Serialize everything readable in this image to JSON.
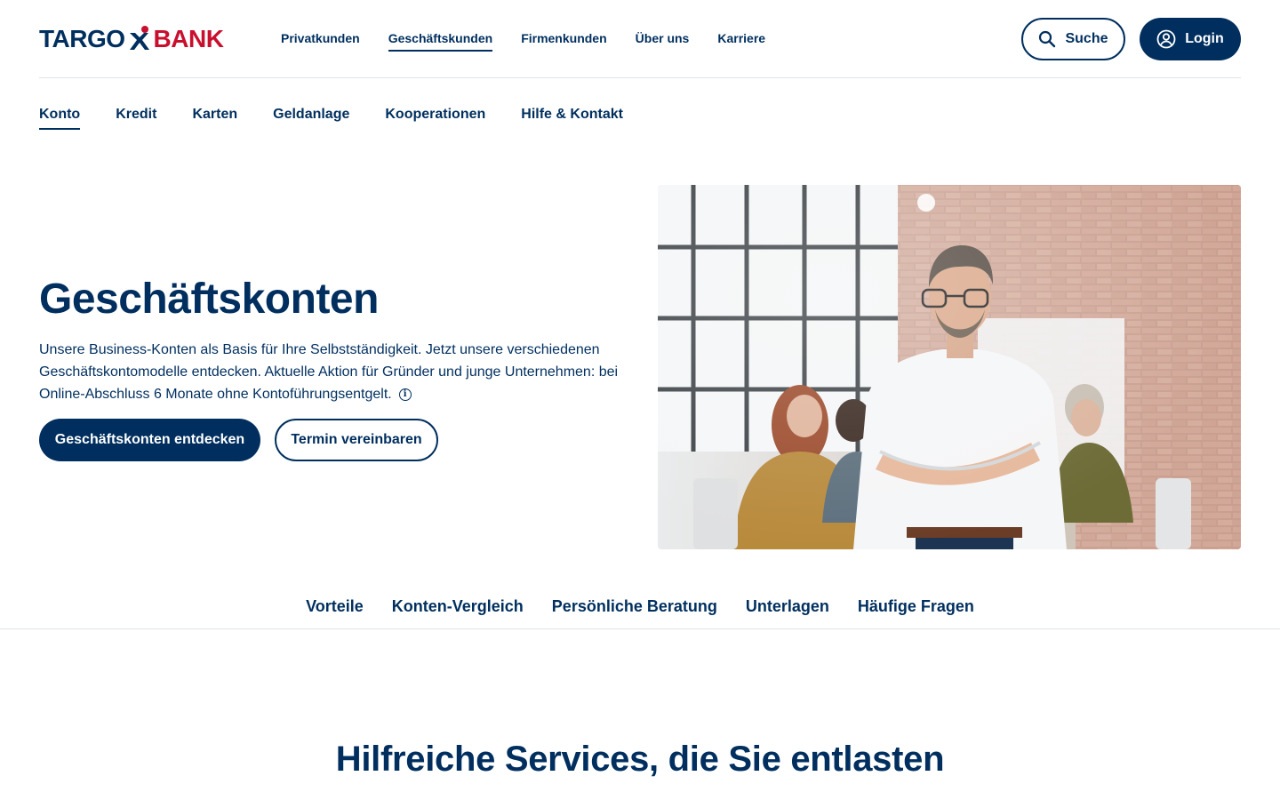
{
  "brand": {
    "part1": "TARGO",
    "part2": "BANK",
    "colors": {
      "navy": "#002f5f",
      "red": "#c8102e"
    }
  },
  "topnav": {
    "items": [
      {
        "label": "Privatkunden",
        "active": false
      },
      {
        "label": "Geschäftskunden",
        "active": true
      },
      {
        "label": "Firmenkunden",
        "active": false
      },
      {
        "label": "Über uns",
        "active": false
      },
      {
        "label": "Karriere",
        "active": false
      }
    ]
  },
  "header_actions": {
    "search_label": "Suche",
    "search_icon": "search-icon",
    "login_label": "Login",
    "login_icon": "user-circle-icon"
  },
  "subnav": {
    "items": [
      {
        "label": "Konto",
        "active": true
      },
      {
        "label": "Kredit",
        "active": false
      },
      {
        "label": "Karten",
        "active": false
      },
      {
        "label": "Geldanlage",
        "active": false
      },
      {
        "label": "Kooperationen",
        "active": false
      },
      {
        "label": "Hilfe & Kontakt",
        "active": false
      }
    ]
  },
  "hero": {
    "title": "Geschäftskonten",
    "text": "Unsere Business-Konten als Basis für Ihre Selbstständigkeit. Jetzt unsere verschiedenen Geschäftskontomodelle entdecken. Aktuelle Aktion für Gründer und junge Unternehmen: bei Online-Abschluss 6 Monate ohne Kontoführungsentgelt.",
    "info_icon": "info-icon",
    "primary_cta": "Geschäftskonten entdecken",
    "secondary_cta": "Termin vereinbaren"
  },
  "anchornav": {
    "items": [
      "Vorteile",
      "Konten-Vergleich",
      "Persönliche Beratung",
      "Unterlagen",
      "Häufige Fragen"
    ]
  },
  "services": {
    "title": "Hilfreiche Services, die Sie entlasten"
  }
}
